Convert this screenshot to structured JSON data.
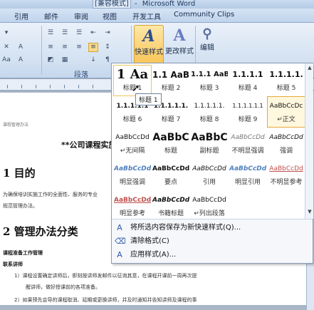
{
  "window": {
    "mode": "[兼容模式]",
    "app": "Microsoft Word",
    "separator": "-"
  },
  "tabs": [
    "引用",
    "邮件",
    "审阅",
    "视图",
    "开发工具",
    "Community Clips"
  ],
  "ribbon": {
    "paragraph_group": "段落",
    "quick_styles": "快速样式",
    "change_styles": "更改样式",
    "editing": "编辑",
    "big_glyph": "A"
  },
  "document": {
    "header_note": "课程管理办法",
    "title": "**公司课程实施",
    "h1_goal": "1 目的",
    "goal_text": "为确保培训实施工作的全面性、服务的专业",
    "goal_text2": "规范管理办法。",
    "h1_method": "2 管理办法分类",
    "course_prep": "课程准备工作管理",
    "contact": "联系讲师",
    "item1": "1）课程设置确定讲师后，即刻按讲师发邮件以征询其意，在课程开课前一周再次提",
    "item1b": "醒讲师，做好授课前的各项准备。",
    "item2": "2）如果预先会导的课程取消、延期或更换讲师，并及时通知并告知讲师及课程的事"
  },
  "styles": [
    {
      "preview": "1 Aa",
      "label": "标题 1"
    },
    {
      "preview": "1.1 AaB",
      "label": "标题 2"
    },
    {
      "preview": "1.1.1 AaB",
      "label": "标题 3"
    },
    {
      "preview": "1.1.1.1",
      "label": "标题 4"
    },
    {
      "preview": "1.1.1.1.",
      "label": "标题 5"
    },
    {
      "preview": "1.1.1.1.1",
      "label": "标题 6"
    },
    {
      "preview": "1.1.1.1.1.",
      "label": "标题 7"
    },
    {
      "preview": "1.1.1.1.1.",
      "label": "标题 8"
    },
    {
      "preview": "1.1.1.1.1.1",
      "label": "标题 9"
    },
    {
      "preview": "AaBbCcDc",
      "label": "↵正文"
    },
    {
      "preview": "AaBbCcDd",
      "label": "↵无间隔"
    },
    {
      "preview": "AaBbC",
      "label": "标题"
    },
    {
      "preview": "AaBbC",
      "label": "副标题"
    },
    {
      "preview": "AaBbCcDd",
      "label": "不明显强调"
    },
    {
      "preview": "AaBbCcDd",
      "label": "强调"
    },
    {
      "preview": "AaBbCcDd",
      "label": "明显强调"
    },
    {
      "preview": "AaBbCcDd",
      "label": "要点"
    },
    {
      "preview": "AaBbCcDd",
      "label": "引用"
    },
    {
      "preview": "AaBbCcDd",
      "label": "明显引用"
    },
    {
      "preview": "AaBbCcDd",
      "label": "不明显参考"
    },
    {
      "preview": "AaBbCcDd",
      "label": "明显参考"
    },
    {
      "preview": "AaBbCcDd",
      "label": "书籍标题"
    },
    {
      "preview": "AaBbCcDd",
      "label": "↵列出段落"
    }
  ],
  "tooltip": "标题 1",
  "menu": {
    "save_selection": "将所选内容保存为新快速样式(Q)...",
    "clear_format": "清除格式(C)",
    "apply_styles": "应用样式(A)..."
  },
  "colors": {
    "accent": "#f8c455",
    "ribbon_bg": "#d3e1f1",
    "heading_blue": "#1f497d",
    "link_blue": "#4f81bd",
    "red": "#c0504d"
  }
}
